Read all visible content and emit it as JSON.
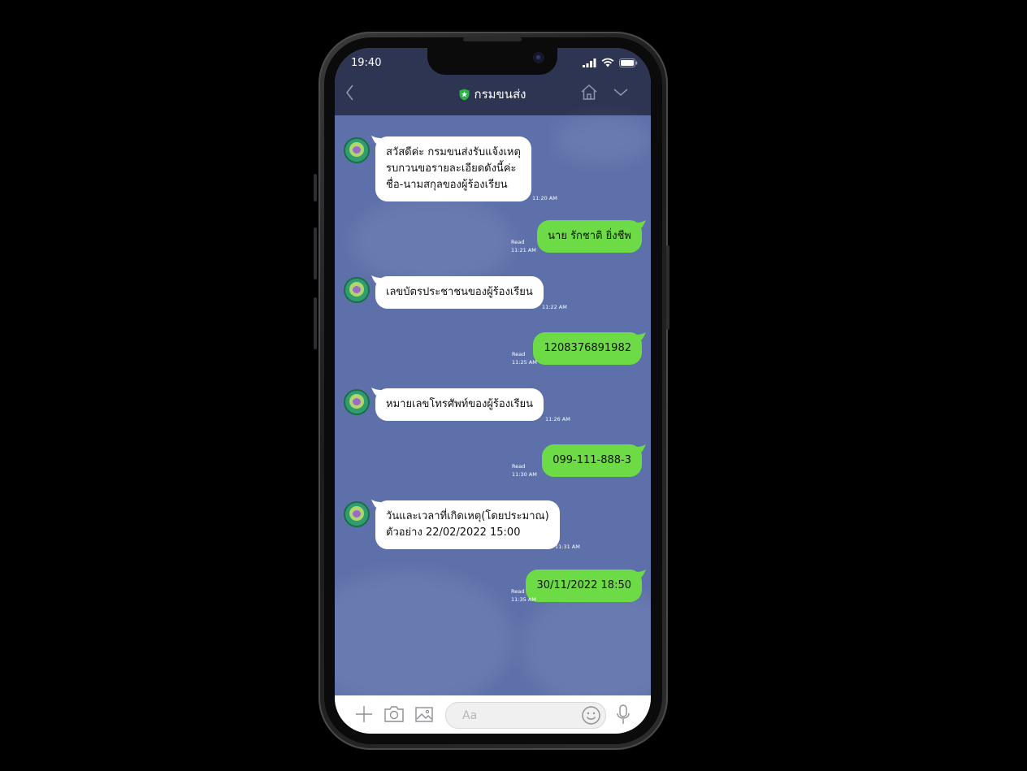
{
  "status": {
    "time": "19:40"
  },
  "header": {
    "title": "กรมขนส่ง"
  },
  "messages": [
    {
      "dir": "in",
      "text": "สวัสดีค่ะ กรมขนส่งรับแจ้งเหตุ\nรบกวนขอรายละเอียดดังนี้ค่ะ\nชื่อ-นามสกุลของผู้ร้องเรียน",
      "time": "11:20 AM"
    },
    {
      "dir": "out",
      "text": "นาย รักชาติ ยิ่งชีพ",
      "read": "Read",
      "time": "11:21 AM"
    },
    {
      "dir": "in",
      "text": "เลขบัตรประชาชนของผู้ร้องเรียน",
      "time": "11:22 AM"
    },
    {
      "dir": "out",
      "text": "1208376891982",
      "read": "Read",
      "time": "11:25 AM"
    },
    {
      "dir": "in",
      "text": "หมายเลขโทรศัพท์ของผู้ร้องเรียน",
      "time": "11:26 AM"
    },
    {
      "dir": "out",
      "text": "099-111-888-3",
      "read": "Read",
      "time": "11:30 AM"
    },
    {
      "dir": "in",
      "text": "วันและเวลาที่เกิดเหตุ(โดยประมาณ)\nตัวอย่าง 22/02/2022 15:00",
      "time": "11:31 AM"
    },
    {
      "dir": "out",
      "text": "30/11/2022 18:50",
      "read": "Read",
      "time": "11:35 AM"
    }
  ],
  "input": {
    "placeholder": "Aa"
  },
  "colors": {
    "header": "#2e3552",
    "chat_bg": "#5d70a9",
    "outgoing": "#6ddb45",
    "incoming": "#ffffff",
    "badge": "#2db34a"
  }
}
